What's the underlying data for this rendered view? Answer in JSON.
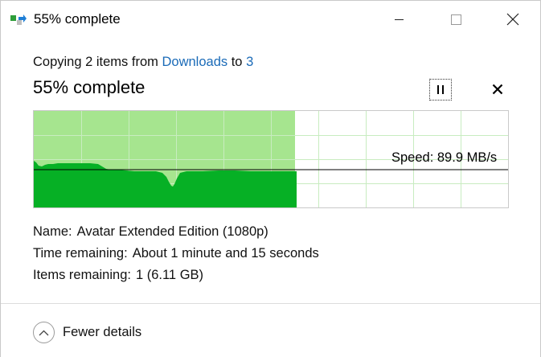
{
  "window": {
    "title": "55% complete",
    "close_glyph": "✕"
  },
  "copy": {
    "prefix": "Copying 2 items from ",
    "source": "Downloads",
    "middle": " to ",
    "destination": "3"
  },
  "progress": {
    "heading": "55% complete",
    "fraction": 0.55,
    "cancel_glyph": "✕"
  },
  "speed": {
    "label": "Speed: 89.9 MB/s"
  },
  "details": {
    "name_label": "Name:",
    "name_value": "Avatar Extended Edition (1080p)",
    "time_label": "Time remaining:",
    "time_value": "About 1 minute and 15 seconds",
    "items_label": "Items remaining:",
    "items_value": "1 (6.11 GB)"
  },
  "footer": {
    "toggle_label": "Fewer details"
  },
  "colors": {
    "progress_fill": "#a6e58f",
    "speed_fill": "#06b025",
    "link": "#1b6bb8",
    "grid": "#c8ecc0"
  }
}
